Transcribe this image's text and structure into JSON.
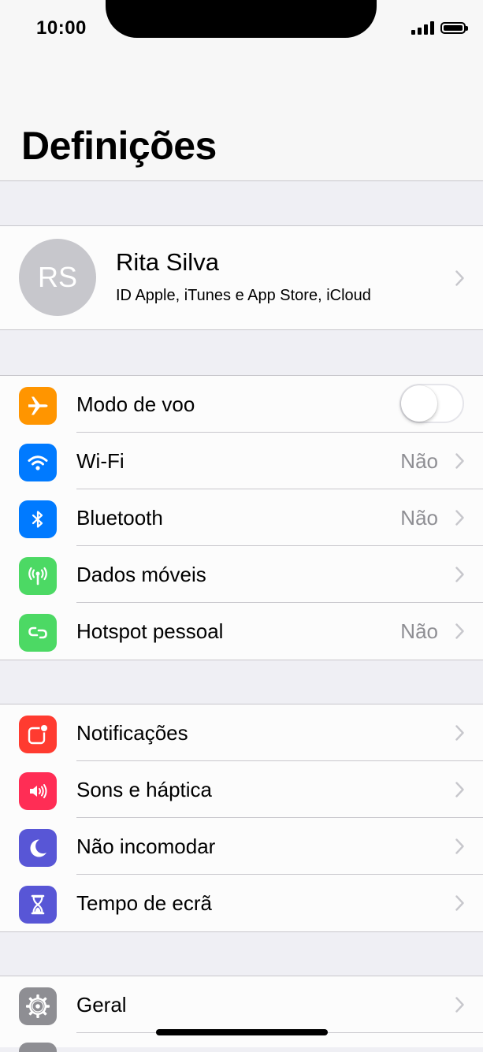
{
  "status_bar": {
    "time": "10:00"
  },
  "header": {
    "title": "Definições"
  },
  "profile": {
    "initials": "RS",
    "name": "Rita Silva",
    "subtitle": "ID Apple, iTunes e App Store, iCloud"
  },
  "connectivity": {
    "airplane": {
      "label": "Modo de voo",
      "toggle_on": false
    },
    "wifi": {
      "label": "Wi-Fi",
      "value": "Não"
    },
    "bluetooth": {
      "label": "Bluetooth",
      "value": "Não"
    },
    "mobile_data": {
      "label": "Dados móveis"
    },
    "hotspot": {
      "label": "Hotspot pessoal",
      "value": "Não"
    }
  },
  "notifications_group": {
    "notifications": {
      "label": "Notificações"
    },
    "sounds": {
      "label": "Sons e háptica"
    },
    "dnd": {
      "label": "Não incomodar"
    },
    "screen_time": {
      "label": "Tempo de ecrã"
    }
  },
  "general_group": {
    "general": {
      "label": "Geral"
    }
  },
  "colors": {
    "airplane": "#ff9500",
    "wifi": "#007aff",
    "bluetooth": "#007aff",
    "mobile_data": "#4cd964",
    "hotspot": "#4cd964",
    "notifications": "#ff3b30",
    "sounds": "#ff2d55",
    "dnd": "#5856d6",
    "screen_time": "#5856d6",
    "general": "#8e8e93"
  },
  "icons": [
    "airplane-icon",
    "wifi-icon",
    "bluetooth-icon",
    "antenna-icon",
    "hotspot-icon",
    "notifications-icon",
    "speaker-icon",
    "moon-icon",
    "hourglass-icon",
    "gear-icon",
    "chevron-right-icon"
  ]
}
